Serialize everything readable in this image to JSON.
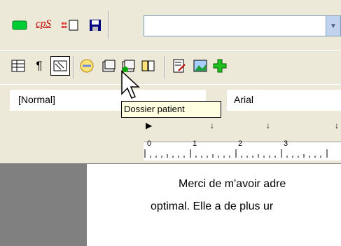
{
  "toolbar1": {
    "cps_label": "cpS",
    "combo_value": ""
  },
  "format_bar": {
    "style_value": "[Normal]",
    "font_value": "Arial"
  },
  "tooltip": {
    "text": "Dossier patient"
  },
  "ruler": {
    "numbers": [
      "0",
      "1",
      "2",
      "3"
    ]
  },
  "document": {
    "line1": "Merci de m'avoir adre",
    "line2": "optimal. Elle a de plus ur"
  }
}
